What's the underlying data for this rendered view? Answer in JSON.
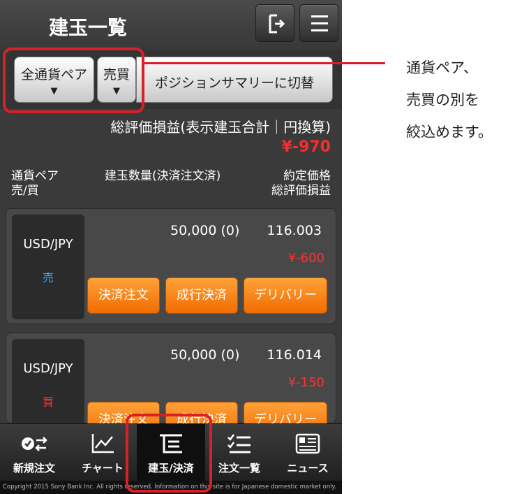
{
  "header": {
    "title": "建玉一覧"
  },
  "filters": {
    "pair_label": "全通貨ペア",
    "side_label": "売買",
    "arrow": "▼",
    "summary_switch_label": "ポジションサマリーに切替"
  },
  "total": {
    "label": "総評価損益(表示建玉合計｜円換算)",
    "value": "¥-970"
  },
  "columns": {
    "left_1": "通貨ペア",
    "left_2": "売/買",
    "mid": "建玉数量(決済注文済)",
    "right_1": "約定価格",
    "right_2": "総評価損益"
  },
  "positions": [
    {
      "pair": "USD/JPY",
      "side": "売",
      "quantity": "50,000 (0)",
      "price": "116.003",
      "pnl": "¥-600"
    },
    {
      "pair": "USD/JPY",
      "side": "買",
      "quantity": "50,000 (0)",
      "price": "116.014",
      "pnl": "¥-150"
    }
  ],
  "row_buttons": {
    "settle": "決済注文",
    "market_settle": "成行決済",
    "delivery": "デリバリー"
  },
  "tabs": [
    {
      "label": "新規注文",
      "icon": "new-order-icon"
    },
    {
      "label": "チャート",
      "icon": "chart-icon"
    },
    {
      "label": "建玉/決済",
      "icon": "positions-icon",
      "active": true
    },
    {
      "label": "注文一覧",
      "icon": "order-list-icon"
    },
    {
      "label": "ニュース",
      "icon": "news-icon"
    }
  ],
  "copyright": "Copyright 2015 Sony Bank Inc. All rights reserved. Information on this site is for Japanese domestic market only.",
  "annotation": {
    "line1": "通貨ペア、",
    "line2": "売買の別を",
    "line3": "絞込めます。"
  },
  "colors": {
    "highlight": "#d6202a",
    "button_orange": "#f58a1f",
    "loss_red": "#ff2a2a",
    "sell_blue": "#2aa8ff"
  }
}
